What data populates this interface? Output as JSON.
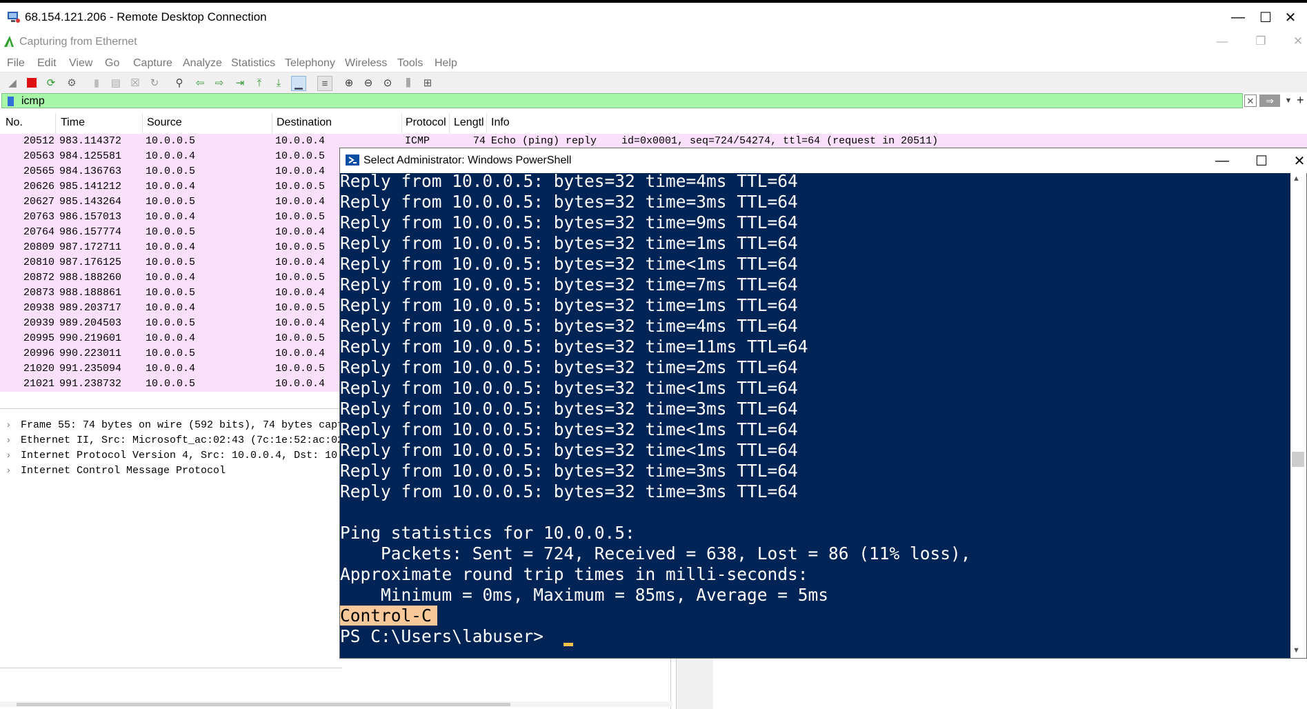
{
  "rdp": {
    "title": "68.154.121.206 - Remote Desktop Connection",
    "minimize": "—",
    "maximize": "☐",
    "close": "✕"
  },
  "wireshark": {
    "title": "Capturing from Ethernet",
    "menu": [
      "File",
      "Edit",
      "View",
      "Go",
      "Capture",
      "Analyze",
      "Statistics",
      "Telephony",
      "Wireless",
      "Tools",
      "Help"
    ],
    "filter": {
      "value": "icmp"
    },
    "columns": [
      "No.",
      "Time",
      "Source",
      "Destination",
      "Protocol",
      "Lengtl",
      "Info"
    ],
    "first_row": {
      "no": "20512",
      "time": "983.114372",
      "src": "10.0.0.5",
      "dst": "10.0.0.4",
      "proto": "ICMP",
      "len": "74",
      "info": "Echo (ping) reply    id=0x0001, seq=724/54274, ttl=64 (request in 20511)"
    },
    "rows": [
      {
        "no": "20563",
        "time": "984.125581",
        "src": "10.0.0.4",
        "dst": "10.0.0.5"
      },
      {
        "no": "20565",
        "time": "984.136763",
        "src": "10.0.0.5",
        "dst": "10.0.0.4"
      },
      {
        "no": "20626",
        "time": "985.141212",
        "src": "10.0.0.4",
        "dst": "10.0.0.5"
      },
      {
        "no": "20627",
        "time": "985.143264",
        "src": "10.0.0.5",
        "dst": "10.0.0.4"
      },
      {
        "no": "20763",
        "time": "986.157013",
        "src": "10.0.0.4",
        "dst": "10.0.0.5"
      },
      {
        "no": "20764",
        "time": "986.157774",
        "src": "10.0.0.5",
        "dst": "10.0.0.4"
      },
      {
        "no": "20809",
        "time": "987.172711",
        "src": "10.0.0.4",
        "dst": "10.0.0.5"
      },
      {
        "no": "20810",
        "time": "987.176125",
        "src": "10.0.0.5",
        "dst": "10.0.0.4"
      },
      {
        "no": "20872",
        "time": "988.188260",
        "src": "10.0.0.4",
        "dst": "10.0.0.5"
      },
      {
        "no": "20873",
        "time": "988.188861",
        "src": "10.0.0.5",
        "dst": "10.0.0.4"
      },
      {
        "no": "20938",
        "time": "989.203717",
        "src": "10.0.0.4",
        "dst": "10.0.0.5"
      },
      {
        "no": "20939",
        "time": "989.204503",
        "src": "10.0.0.5",
        "dst": "10.0.0.4"
      },
      {
        "no": "20995",
        "time": "990.219601",
        "src": "10.0.0.4",
        "dst": "10.0.0.5"
      },
      {
        "no": "20996",
        "time": "990.223011",
        "src": "10.0.0.5",
        "dst": "10.0.0.4"
      },
      {
        "no": "21020",
        "time": "991.235094",
        "src": "10.0.0.4",
        "dst": "10.0.0.5"
      },
      {
        "no": "21021",
        "time": "991.238732",
        "src": "10.0.0.5",
        "dst": "10.0.0.4"
      }
    ],
    "details": [
      "Frame 55: 74 bytes on wire (592 bits), 74 bytes capt",
      "Ethernet II, Src: Microsoft_ac:02:43 (7c:1e:52:ac:02",
      "Internet Protocol Version 4, Src: 10.0.0.4, Dst: 10.",
      "Internet Control Message Protocol"
    ]
  },
  "powershell": {
    "title": "Select Administrator: Windows PowerShell",
    "replies": [
      "Reply from 10.0.0.5: bytes=32 time=4ms TTL=64",
      "Reply from 10.0.0.5: bytes=32 time=3ms TTL=64",
      "Reply from 10.0.0.5: bytes=32 time=9ms TTL=64",
      "Reply from 10.0.0.5: bytes=32 time=1ms TTL=64",
      "Reply from 10.0.0.5: bytes=32 time<1ms TTL=64",
      "Reply from 10.0.0.5: bytes=32 time=7ms TTL=64",
      "Reply from 10.0.0.5: bytes=32 time=1ms TTL=64",
      "Reply from 10.0.0.5: bytes=32 time=4ms TTL=64",
      "Reply from 10.0.0.5: bytes=32 time=11ms TTL=64",
      "Reply from 10.0.0.5: bytes=32 time=2ms TTL=64",
      "Reply from 10.0.0.5: bytes=32 time<1ms TTL=64",
      "Reply from 10.0.0.5: bytes=32 time=3ms TTL=64",
      "Reply from 10.0.0.5: bytes=32 time<1ms TTL=64",
      "Reply from 10.0.0.5: bytes=32 time<1ms TTL=64",
      "Reply from 10.0.0.5: bytes=32 time=3ms TTL=64",
      "Reply from 10.0.0.5: bytes=32 time=3ms TTL=64"
    ],
    "stats_header": "Ping statistics for 10.0.0.5:",
    "packets": "    Packets: Sent = 724, Received = 638, Lost = 86 (11% loss),",
    "rtt_header": "Approximate round trip times in milli-seconds:",
    "rtt": "    Minimum = 0ms, Maximum = 85ms, Average = 5ms",
    "ctrl_c": "Control-C",
    "prompt": "PS C:\\Users\\labuser> "
  },
  "colors": {
    "row_bg": "#fbe0fb",
    "filter_bg": "#a8f7a8",
    "ps_bg": "#012456",
    "highlight": "#f9c89a"
  }
}
